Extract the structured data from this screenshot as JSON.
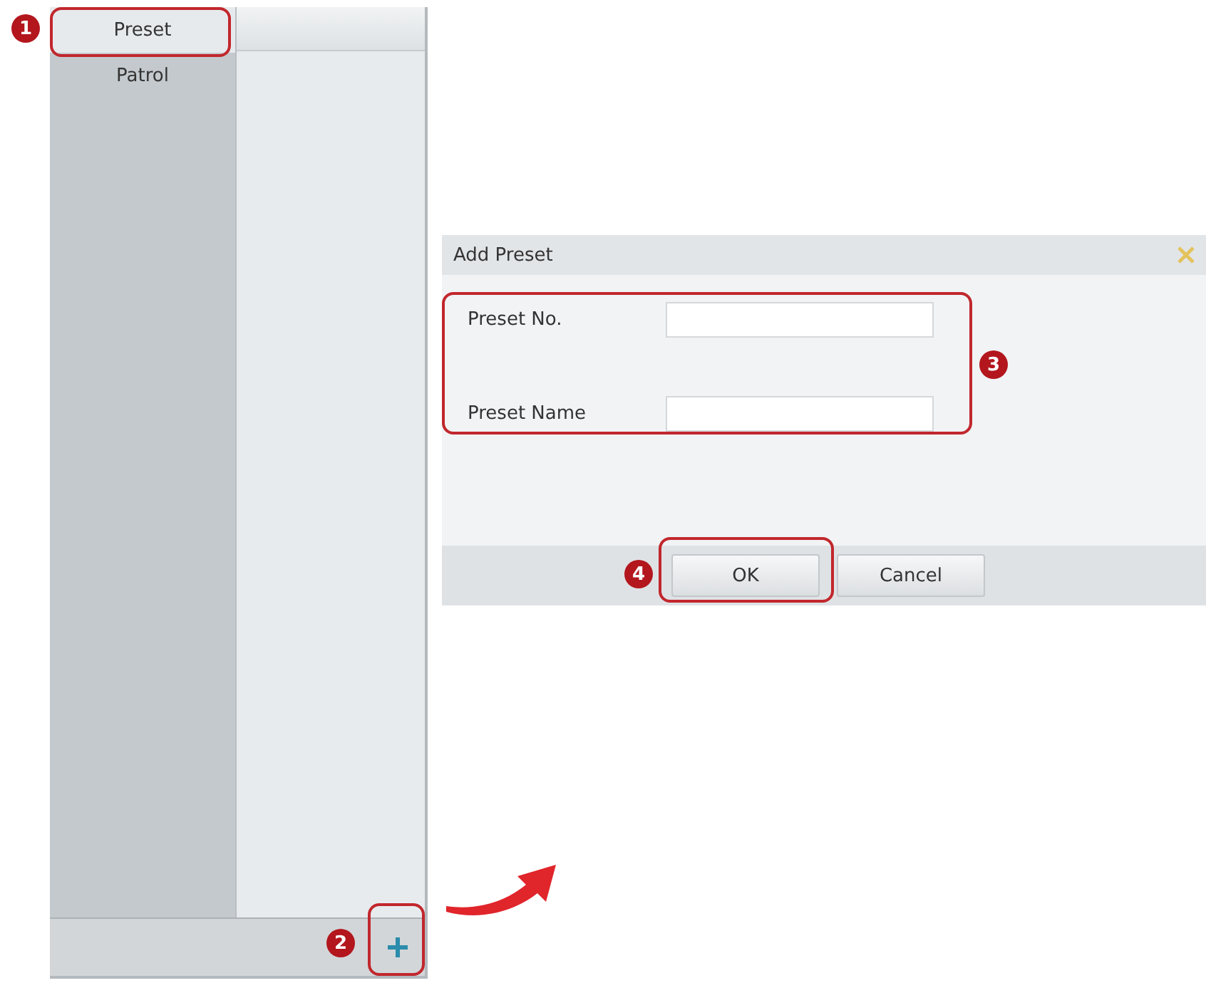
{
  "side_panel": {
    "tabs": [
      {
        "label": "Preset",
        "selected": true,
        "callout": "1"
      },
      {
        "label": "Patrol",
        "selected": false
      }
    ],
    "add_button": {
      "callout": "2"
    }
  },
  "dialog": {
    "title": "Add Preset",
    "form": {
      "callout": "3",
      "fields": [
        {
          "label": "Preset No."
        },
        {
          "label": "Preset Name"
        }
      ]
    },
    "buttons": [
      {
        "label": "OK",
        "callout": "4"
      },
      {
        "label": "Cancel"
      }
    ]
  }
}
